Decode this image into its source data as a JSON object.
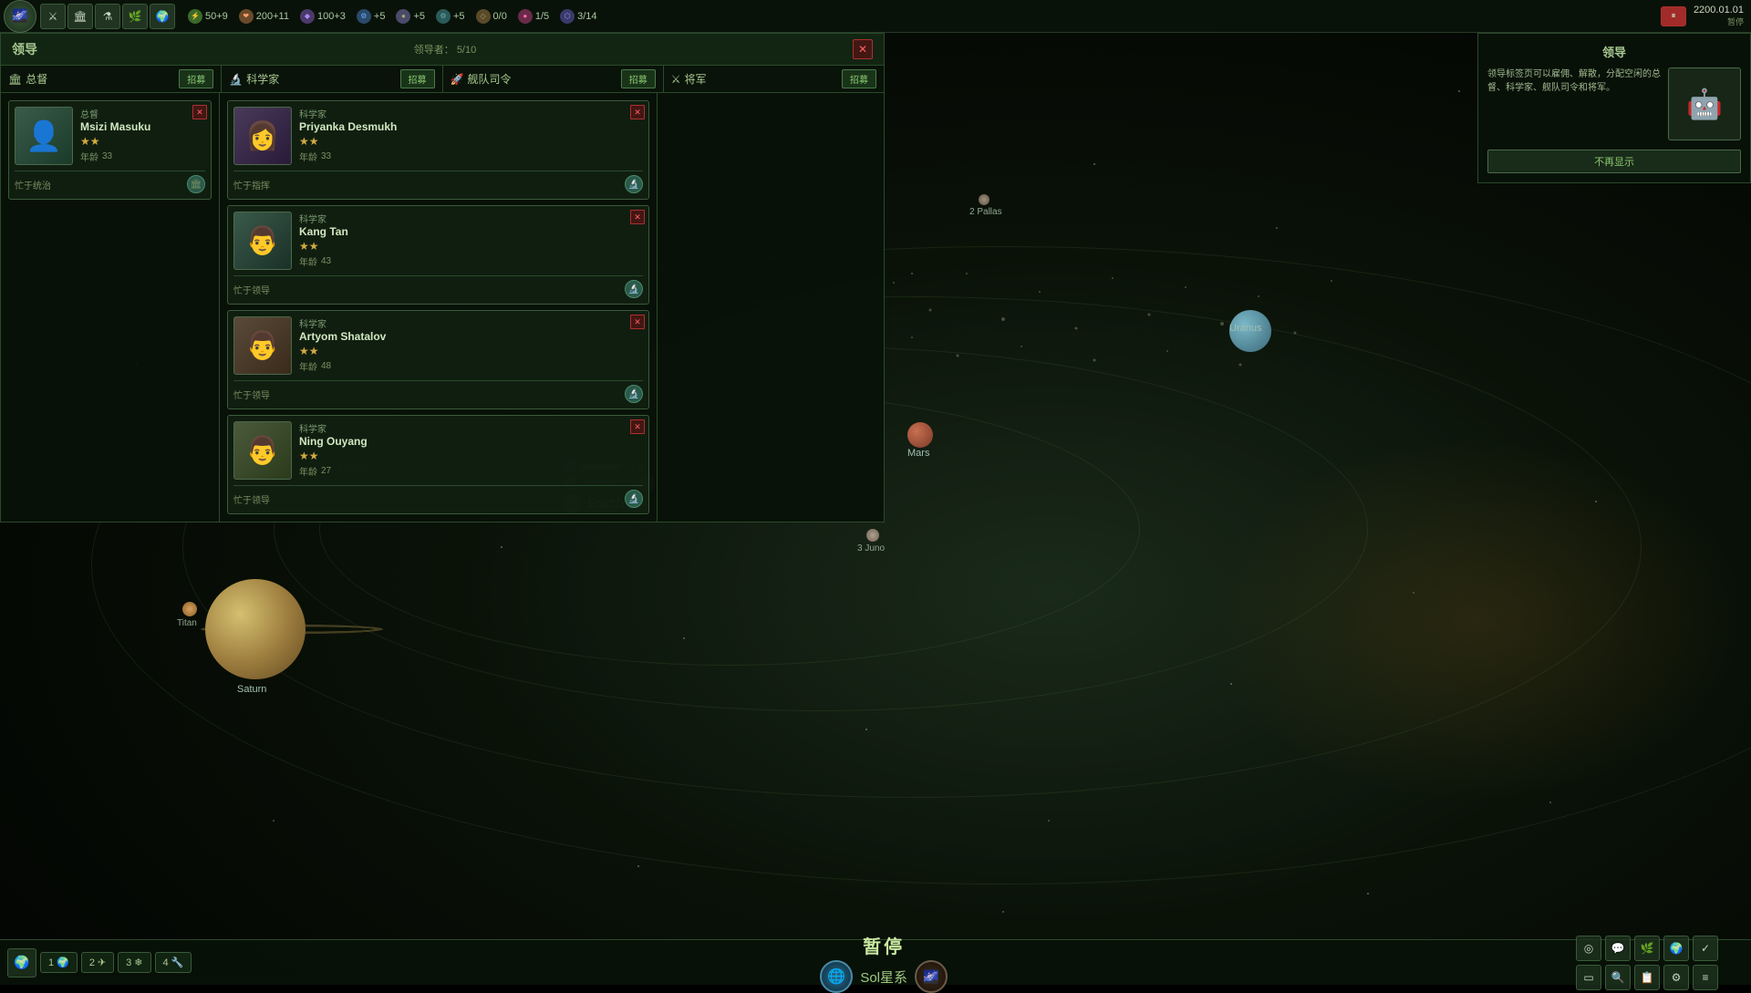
{
  "game": {
    "date": "2200.01.01",
    "paused_label": "暂停",
    "system_name": "Sol星系"
  },
  "top_bar": {
    "resources": [
      {
        "id": "energy",
        "icon": "⚡",
        "value": "50+9",
        "color": "#8afa6a"
      },
      {
        "id": "food",
        "icon": "❤",
        "value": "200+11",
        "color": "#fa8a6a"
      },
      {
        "id": "minerals",
        "icon": "◆",
        "value": "100+3",
        "color": "#aa8afa"
      },
      {
        "id": "influence",
        "icon": "⚙",
        "value": "+5",
        "color": "#6aaaaa"
      },
      {
        "id": "unity",
        "icon": "●",
        "value": "+5",
        "color": "#aad870"
      },
      {
        "id": "tech",
        "icon": "⚙",
        "value": "+5",
        "color": "#70aaaa"
      },
      {
        "id": "alloys",
        "icon": "◇",
        "value": "0/0",
        "color": "#aaa06a"
      },
      {
        "id": "consumer",
        "icon": "●",
        "value": "1/5",
        "color": "#aa8a6a"
      },
      {
        "id": "stratres",
        "icon": "⬡",
        "value": "3/14",
        "color": "#9a9afa"
      }
    ]
  },
  "leader_panel": {
    "title": "领导",
    "leader_count": "5/10",
    "leader_label": "领导者：",
    "tabs": [
      {
        "id": "governor",
        "label": "总督",
        "recruit_label": "招募"
      },
      {
        "id": "scientist",
        "label": "科学家",
        "recruit_label": "招募",
        "icon": "🔬"
      },
      {
        "id": "fleet_commander",
        "label": "舰队司令",
        "recruit_label": "招募",
        "icon": "🚀"
      },
      {
        "id": "general",
        "label": "将军",
        "recruit_label": "招募",
        "icon": "⚔"
      }
    ],
    "governors": [
      {
        "type": "总督",
        "name": "Msizi Masuku",
        "stars": 2,
        "age_label": "年龄",
        "age": 33,
        "status": "忙于统治",
        "portrait": "👤"
      }
    ],
    "scientists": [
      {
        "type": "科学家",
        "name": "Priyanka Desmukh",
        "stars": 2,
        "age_label": "年龄",
        "age": 33,
        "status": "忙于指挥",
        "portrait": "👩"
      },
      {
        "type": "科学家",
        "name": "Kang Tan",
        "stars": 2,
        "age_label": "年龄",
        "age": 43,
        "status": "忙于领导",
        "portrait": "👨"
      },
      {
        "type": "科学家",
        "name": "Artyom Shatalov",
        "stars": 2,
        "age_label": "年龄",
        "age": 48,
        "status": "忙于领导",
        "portrait": "👨"
      },
      {
        "type": "科学家",
        "name": "Ning Ouyang",
        "stars": 2,
        "age_label": "年龄",
        "age": 27,
        "status": "忙于领导",
        "portrait": "👨"
      }
    ]
  },
  "right_panel": {
    "title": "领导",
    "description": "领导标签页可以雇佣、解散，分配空闲的总督、科学家、舰队司令和将军。",
    "dont_show": "不再显示"
  },
  "earth": {
    "name": "Earth",
    "bar1_fill": 75,
    "bar2_fill": 60
  },
  "planets": {
    "uranus": "Uranus",
    "mars": "Mars",
    "saturn": "Saturn",
    "titan": "Titan",
    "pallas": "2 Pallas",
    "vesta": "4 Vesta",
    "juno": "3 Juno"
  },
  "bottom_bar": {
    "paused": "暂停",
    "system": "Sol星系",
    "tabs": [
      {
        "num": "1",
        "label": "",
        "icon": "🌍"
      },
      {
        "num": "2",
        "label": "",
        "icon": "✈"
      },
      {
        "num": "3",
        "label": "",
        "icon": "❄"
      },
      {
        "num": "4",
        "label": "",
        "icon": "🔧"
      }
    ]
  },
  "icons": {
    "pause": "⏸",
    "play": "▶",
    "close": "✕",
    "star_full": "★",
    "star_empty": "☆",
    "search": "🔍",
    "gear": "⚙",
    "globe": "🌐",
    "galaxy": "🌌"
  }
}
